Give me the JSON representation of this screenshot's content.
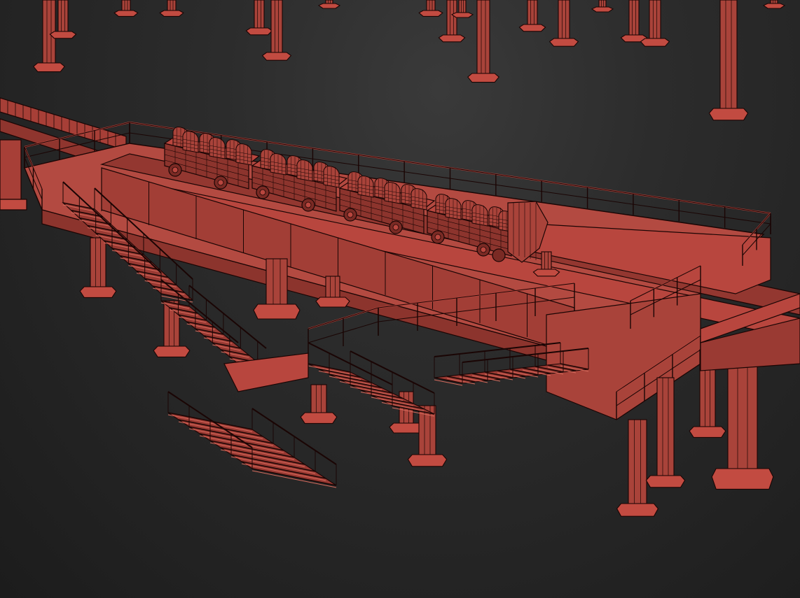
{
  "viewport": {
    "background_top": "#3a3a3a",
    "background_bottom": "#1b1b1b"
  },
  "scene": {
    "render_style": "wireframe-over-shaded",
    "fill_color": "#b8463e",
    "fill_dark": "#7a2a24",
    "edge_color": "#1a0504",
    "highlight_color": "#d66a5c",
    "train_cars": 4,
    "seats_per_car": 6
  }
}
